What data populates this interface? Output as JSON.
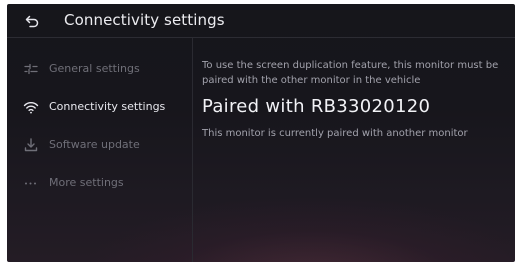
{
  "header": {
    "title": "Connectivity settings",
    "back_icon": "back-arrow-icon"
  },
  "sidebar": {
    "items": [
      {
        "label": "General settings",
        "icon": "sliders-icon",
        "active": false
      },
      {
        "label": "Connectivity settings",
        "icon": "wifi-icon",
        "active": true
      },
      {
        "label": "Software update",
        "icon": "download-icon",
        "active": false
      },
      {
        "label": "More settings",
        "icon": "more-dots-icon",
        "active": false
      }
    ]
  },
  "main": {
    "description": "To use the screen duplication feature, this monitor must be paired with the other monitor in the vehicle",
    "status_title": "Paired with RB33020120",
    "status_subtitle": "This monitor is currently paired with another monitor"
  },
  "colors": {
    "background": "#17161c",
    "text_active": "#e8e8ee",
    "text_inactive": "#6f6f78",
    "text_secondary": "#a2a2ac"
  }
}
